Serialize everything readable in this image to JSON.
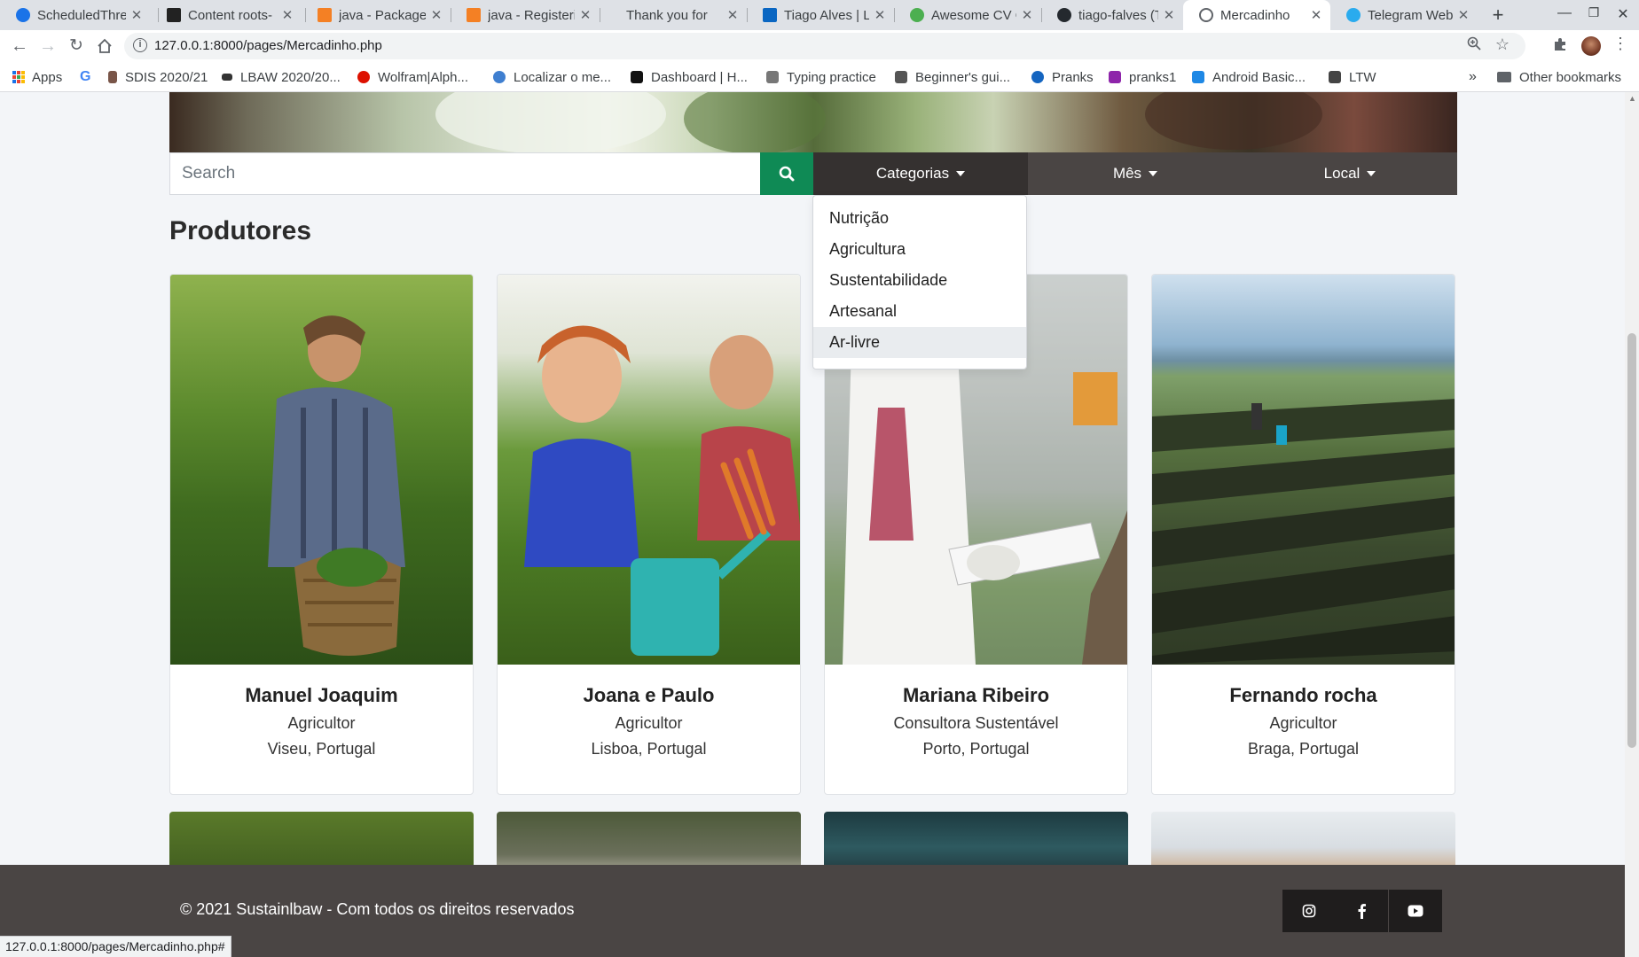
{
  "browser": {
    "tabs": [
      {
        "title": "ScheduledThre",
        "favicon_color": "#1a73e8"
      },
      {
        "title": "Content roots-",
        "favicon_color": "#222222"
      },
      {
        "title": "java - Package",
        "favicon_color": "#f48024"
      },
      {
        "title": "java - Registeri",
        "favicon_color": "#f48024"
      },
      {
        "title": "Thank you for",
        "favicon_color": "#ffffff"
      },
      {
        "title": "Tiago Alves | Li",
        "favicon_color": "#0a66c2"
      },
      {
        "title": "Awesome CV C",
        "favicon_color": "#4caf50"
      },
      {
        "title": "tiago-falves (Ti",
        "favicon_color": "#24292e"
      },
      {
        "title": "Mercadinho",
        "favicon_color": "#5f6368"
      },
      {
        "title": "Telegram Web",
        "favicon_color": "#2aabee"
      }
    ],
    "new_tab_label": "+",
    "url": "127.0.0.1:8000/pages/Mercadinho.php",
    "bookmarks": [
      {
        "label": "Apps",
        "color": "#1a73e8"
      },
      {
        "label": "",
        "color": "#4285f4"
      },
      {
        "label": "SDIS 2020/21",
        "color": "#795548"
      },
      {
        "label": "LBAW 2020/20...",
        "color": "#333333"
      },
      {
        "label": "Wolfram|Alph...",
        "color": "#dd1100"
      },
      {
        "label": "Localizar o me...",
        "color": "#3f7fd0"
      },
      {
        "label": "Dashboard | H...",
        "color": "#111111"
      },
      {
        "label": "Typing practice",
        "color": "#777777"
      },
      {
        "label": "Beginner's gui...",
        "color": "#555555"
      },
      {
        "label": "Pranks",
        "color": "#1565c0"
      },
      {
        "label": "pranks1",
        "color": "#8e24aa"
      },
      {
        "label": "Android Basic...",
        "color": "#1e88e5"
      },
      {
        "label": "LTW",
        "color": "#444444"
      }
    ],
    "google_letter": "G",
    "overflow_label": "»",
    "other_bookmarks": "Other bookmarks",
    "status_url": "127.0.0.1:8000/pages/Mercadinho.php#"
  },
  "search": {
    "placeholder": "Search"
  },
  "filters": {
    "categorias": "Categorias",
    "mes": "Mês",
    "local": "Local"
  },
  "dropdown": {
    "items": [
      "Nutrição",
      "Agricultura",
      "Sustentabilidade",
      "Artesanal",
      "Ar-livre"
    ],
    "highlighted": "Ar-livre"
  },
  "section_title": "Produtores",
  "producers": [
    {
      "name": "Manuel Joaquim",
      "role": "Agricultor",
      "location": "Viseu, Portugal"
    },
    {
      "name": "Joana e Paulo",
      "role": "Agricultor",
      "location": "Lisboa, Portugal"
    },
    {
      "name": "Mariana Ribeiro",
      "role": "Consultora Sustentável",
      "location": "Porto, Portugal"
    },
    {
      "name": "Fernando rocha",
      "role": "Agricultor",
      "location": "Braga, Portugal"
    }
  ],
  "footer": {
    "copyright": "© 2021 Sustainlbaw - Com todos os direitos reservados",
    "social": [
      "instagram",
      "facebook",
      "youtube"
    ]
  },
  "colors": {
    "accent_green": "#0f8a55",
    "filter_bar": "#4a4544",
    "footer": "#4a4544"
  }
}
